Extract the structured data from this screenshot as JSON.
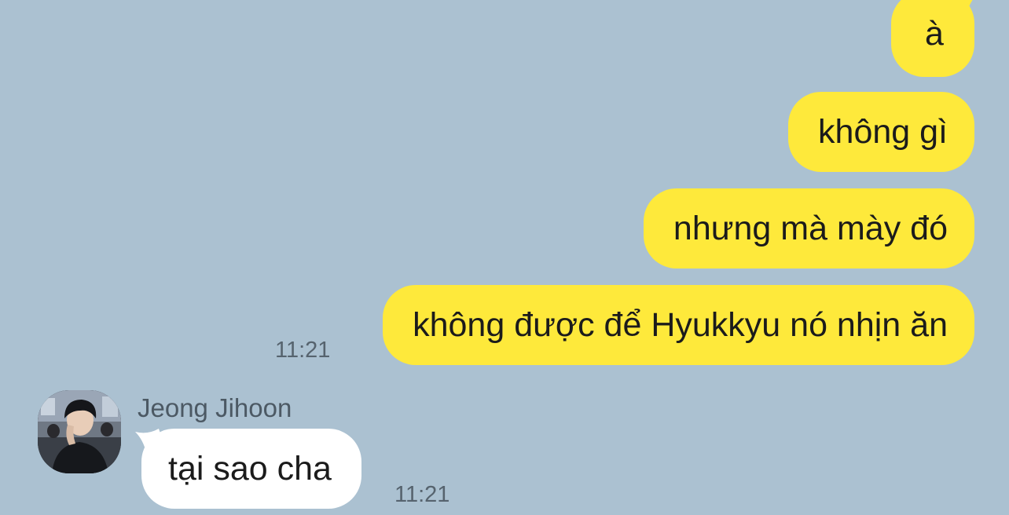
{
  "chat": {
    "background_color": "#abc1d1",
    "outgoing_bubble_color": "#fee93b",
    "incoming_bubble_color": "#ffffff",
    "outgoing_messages": [
      {
        "text": "à"
      },
      {
        "text": "không gì"
      },
      {
        "text": "nhưng mà mày đó"
      },
      {
        "text": "không được để Hyukkyu nó nhịn ăn"
      }
    ],
    "outgoing_time": "11:21",
    "incoming": {
      "sender_name": "Jeong Jihoon",
      "avatar_icon": "profile-photo",
      "text": "tại sao cha",
      "time": "11:21"
    }
  }
}
